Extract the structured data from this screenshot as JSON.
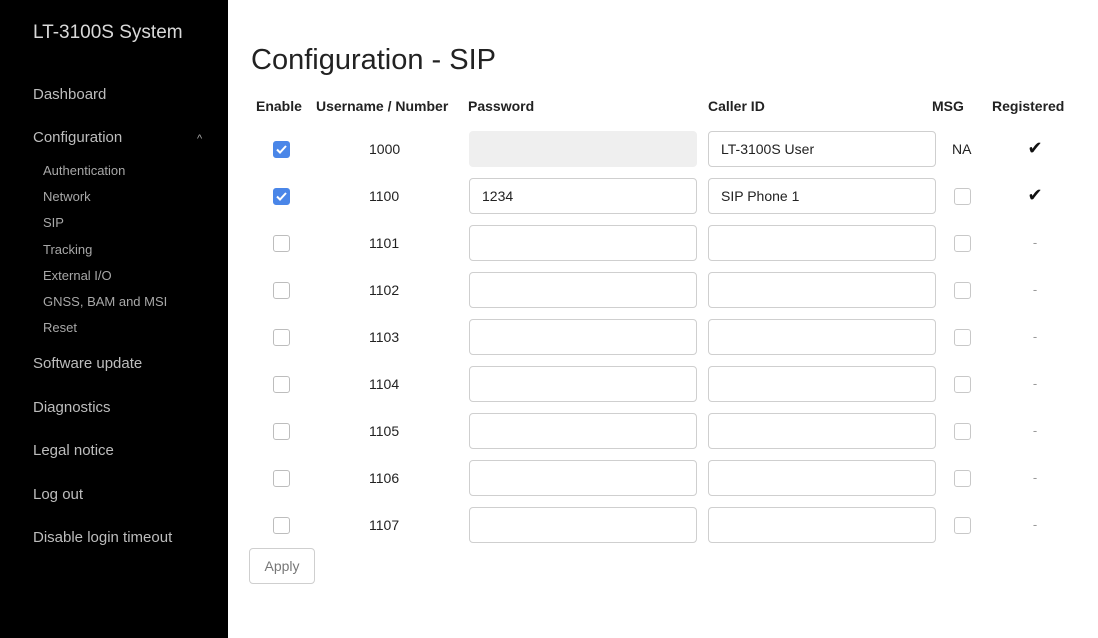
{
  "sidebar": {
    "brand": "LT-3100S System",
    "items": {
      "dashboard": "Dashboard",
      "configuration": "Configuration",
      "software_update": "Software update",
      "diagnostics": "Diagnostics",
      "legal_notice": "Legal notice",
      "log_out": "Log out",
      "disable_login_timeout": "Disable login timeout"
    },
    "config_caret": "^",
    "sub_items": {
      "authentication": "Authentication",
      "network": "Network",
      "sip": "SIP",
      "tracking": "Tracking",
      "external_io": "External I/O",
      "gnss": "GNSS, BAM and MSI",
      "reset": "Reset"
    }
  },
  "main": {
    "title": "Configuration - SIP",
    "headers": {
      "enable": "Enable",
      "username": "Username / Number",
      "password": "Password",
      "caller_id": "Caller ID",
      "msg": "MSG",
      "registered": "Registered"
    },
    "rows": [
      {
        "enabled": true,
        "number": "1000",
        "password": "",
        "password_disabled": true,
        "caller_id": "LT-3100S User",
        "msg": "NA",
        "registered": "✔"
      },
      {
        "enabled": true,
        "number": "1100",
        "password": "1234",
        "password_disabled": false,
        "caller_id": "SIP Phone 1",
        "msg": "",
        "registered": "✔"
      },
      {
        "enabled": false,
        "number": "1101",
        "password": "",
        "password_disabled": false,
        "caller_id": "",
        "msg": "",
        "registered": "-"
      },
      {
        "enabled": false,
        "number": "1102",
        "password": "",
        "password_disabled": false,
        "caller_id": "",
        "msg": "",
        "registered": "-"
      },
      {
        "enabled": false,
        "number": "1103",
        "password": "",
        "password_disabled": false,
        "caller_id": "",
        "msg": "",
        "registered": "-"
      },
      {
        "enabled": false,
        "number": "1104",
        "password": "",
        "password_disabled": false,
        "caller_id": "",
        "msg": "",
        "registered": "-"
      },
      {
        "enabled": false,
        "number": "1105",
        "password": "",
        "password_disabled": false,
        "caller_id": "",
        "msg": "",
        "registered": "-"
      },
      {
        "enabled": false,
        "number": "1106",
        "password": "",
        "password_disabled": false,
        "caller_id": "",
        "msg": "",
        "registered": "-"
      },
      {
        "enabled": false,
        "number": "1107",
        "password": "",
        "password_disabled": false,
        "caller_id": "",
        "msg": "",
        "registered": "-"
      }
    ],
    "apply_label": "Apply"
  }
}
